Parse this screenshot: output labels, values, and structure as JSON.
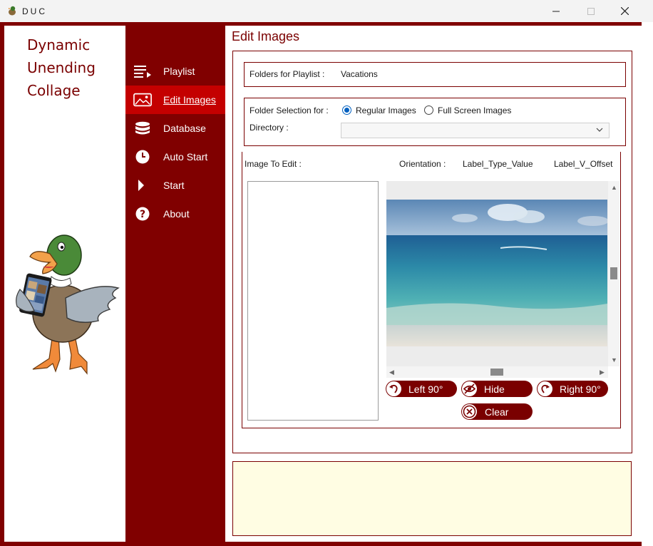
{
  "window": {
    "title": "DUC"
  },
  "logo": {
    "line1": "Dynamic",
    "line2": "Unending",
    "line3": "Collage"
  },
  "nav": {
    "items": [
      {
        "label": "Playlist",
        "icon": "playlist-icon"
      },
      {
        "label": "Edit Images",
        "icon": "image-icon",
        "active": true
      },
      {
        "label": "Database",
        "icon": "database-icon"
      },
      {
        "label": "Auto Start",
        "icon": "clock-icon"
      },
      {
        "label": "Start",
        "icon": "play-icon"
      },
      {
        "label": "About",
        "icon": "help-icon"
      }
    ]
  },
  "page": {
    "title": "Edit Images"
  },
  "folders": {
    "label": "Folders for Playlist :",
    "value": "Vacations"
  },
  "folder_selection": {
    "label": "Folder Selection for :",
    "options": [
      "Regular Images",
      "Full Screen Images"
    ],
    "selected": "Regular Images",
    "directory_label": "Directory :",
    "directory_value": ""
  },
  "editor": {
    "image_to_edit_label": "Image To Edit :",
    "orientation_label": "Orientation :",
    "type_value_label": "Label_Type_Value",
    "v_offset_label": "Label_V_Offset"
  },
  "buttons": {
    "left90": "Left 90°",
    "hide": "Hide",
    "right90": "Right 90°",
    "clear": "Clear"
  },
  "colors": {
    "primary": "#800000",
    "active_nav": "#c40000",
    "message_bg": "#fffde3",
    "radio": "#0060c0"
  }
}
